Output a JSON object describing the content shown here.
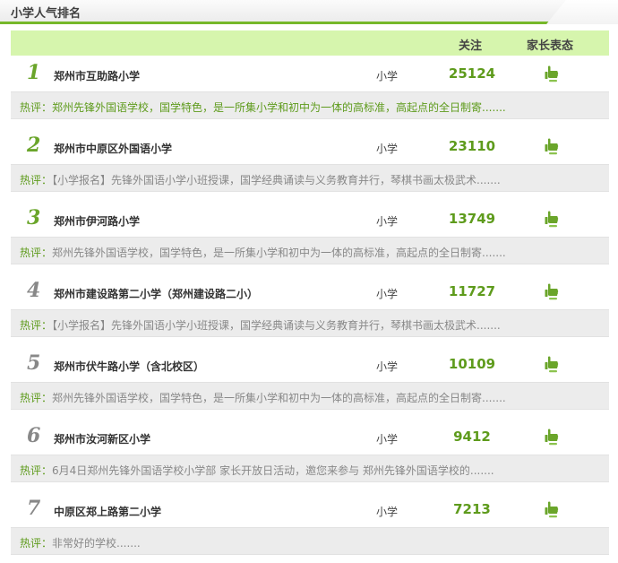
{
  "title": "小学人气排名",
  "header": {
    "follow": "关注",
    "parent": "家长表态"
  },
  "colors": {
    "accent": "#76b82a",
    "header_bg": "#d6f5ad",
    "rank_top": "#6aa52a",
    "rank_other": "#888888",
    "count": "#5e9b1c"
  },
  "icons": {
    "approve": "thumbs-up-icon"
  },
  "comment_label": "热评：",
  "items": [
    {
      "rank": "1",
      "name": "郑州市互助路小学",
      "level": "小学",
      "count": "25124",
      "comment": "郑州先锋外国语学校，国学特色，是一所集小学和初中为一体的高标准，高起点的全日制寄.......",
      "highlight": true
    },
    {
      "rank": "2",
      "name": "郑州市中原区外国语小学",
      "level": "小学",
      "count": "23110",
      "comment": "【小学报名】先锋外国语小学小班授课，国学经典诵读与义务教育并行，琴棋书画太极武术.......",
      "highlight": false
    },
    {
      "rank": "3",
      "name": "郑州市伊河路小学",
      "level": "小学",
      "count": "13749",
      "comment": "郑州先锋外国语学校，国学特色，是一所集小学和初中为一体的高标准，高起点的全日制寄.......",
      "highlight": false
    },
    {
      "rank": "4",
      "name": "郑州市建设路第二小学（郑州建设路二小）",
      "level": "小学",
      "count": "11727",
      "comment": "【小学报名】先锋外国语小学小班授课，国学经典诵读与义务教育并行，琴棋书画太极武术.......",
      "highlight": false
    },
    {
      "rank": "5",
      "name": "郑州市伏牛路小学（含北校区）",
      "level": "小学",
      "count": "10109",
      "comment": "郑州先锋外国语学校，国学特色，是一所集小学和初中为一体的高标准，高起点的全日制寄.......",
      "highlight": false
    },
    {
      "rank": "6",
      "name": "郑州市汝河新区小学",
      "level": "小学",
      "count": "9412",
      "comment": "6月4日郑州先锋外国语学校小学部 家长开放日活动，邀您来参与 郑州先锋外国语学校的.......",
      "highlight": false
    },
    {
      "rank": "7",
      "name": "中原区郑上路第二小学",
      "level": "小学",
      "count": "7213",
      "comment": "非常好的学校.......",
      "highlight": false
    }
  ]
}
